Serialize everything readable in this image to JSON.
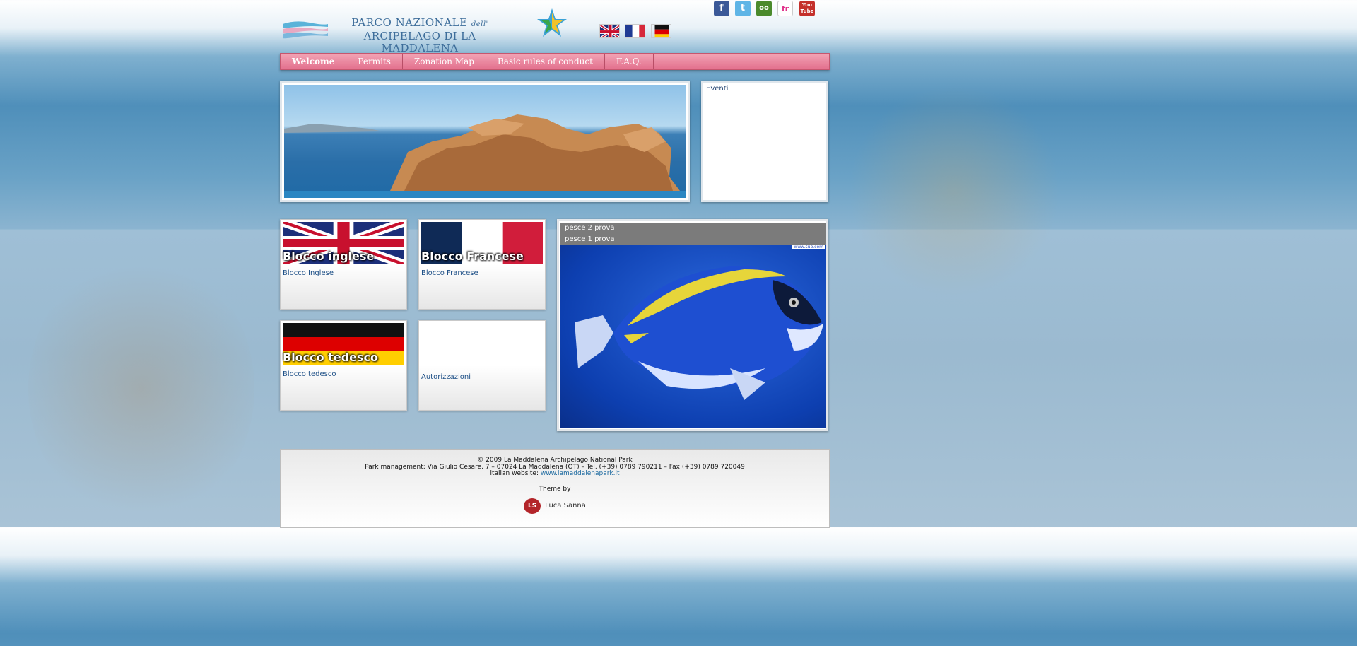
{
  "header": {
    "logo_line1": "PARCO NAZIONALE",
    "logo_line1_small": "dell'",
    "logo_line2": "ARCIPELAGO DI LA MADDALENA",
    "language_flags": [
      {
        "icon": "uk-flag-icon"
      },
      {
        "icon": "france-flag-icon"
      },
      {
        "icon": "germany-flag-icon"
      }
    ],
    "social": [
      {
        "icon": "facebook-icon",
        "glyph": "f",
        "color": "#3b5998"
      },
      {
        "icon": "twitter-icon",
        "glyph": "t",
        "color": "#5fb5e6"
      },
      {
        "icon": "tripadvisor-icon",
        "glyph": "oo",
        "color": "#4b8a2c"
      },
      {
        "icon": "flickr-icon",
        "glyph": "fr",
        "color": "#ffffff"
      },
      {
        "icon": "youtube-icon",
        "glyph": "You Tube",
        "color": "#c4302b"
      }
    ]
  },
  "menu": {
    "items": [
      {
        "label": "Welcome"
      },
      {
        "label": "Permits"
      },
      {
        "label": "Zonation Map"
      },
      {
        "label": "Basic rules of conduct"
      },
      {
        "label": "F.A.Q."
      }
    ]
  },
  "events": {
    "label": "Eventi"
  },
  "blocks": [
    {
      "title": "Blocco inglese",
      "link": "Blocco Inglese"
    },
    {
      "title": "Blocco Francese",
      "link": "Blocco Francese"
    },
    {
      "title": "Blocco tedesco",
      "link": "Blocco tedesco"
    },
    {
      "title": "",
      "link": "Autorizzazioni"
    }
  ],
  "slideshow": {
    "items": [
      {
        "label": "pesce 2 prova"
      },
      {
        "label": "pesce 1 prova"
      }
    ],
    "watermark": "www.sub.com"
  },
  "footer": {
    "copyright": "© 2009 La Maddalena Archipelago National Park",
    "management": "Park management: Via Giulio Cesare, 7 – 07024 La Maddalena (OT) – Tel. (+39) 0789 790211 – Fax (+39) 0789 720049",
    "italian_website_label": "italian website:",
    "italian_website_link": "www.lamaddalenapark.it",
    "theme_by": "Theme by",
    "author_logo": "LS",
    "author": "Luca Sanna"
  }
}
